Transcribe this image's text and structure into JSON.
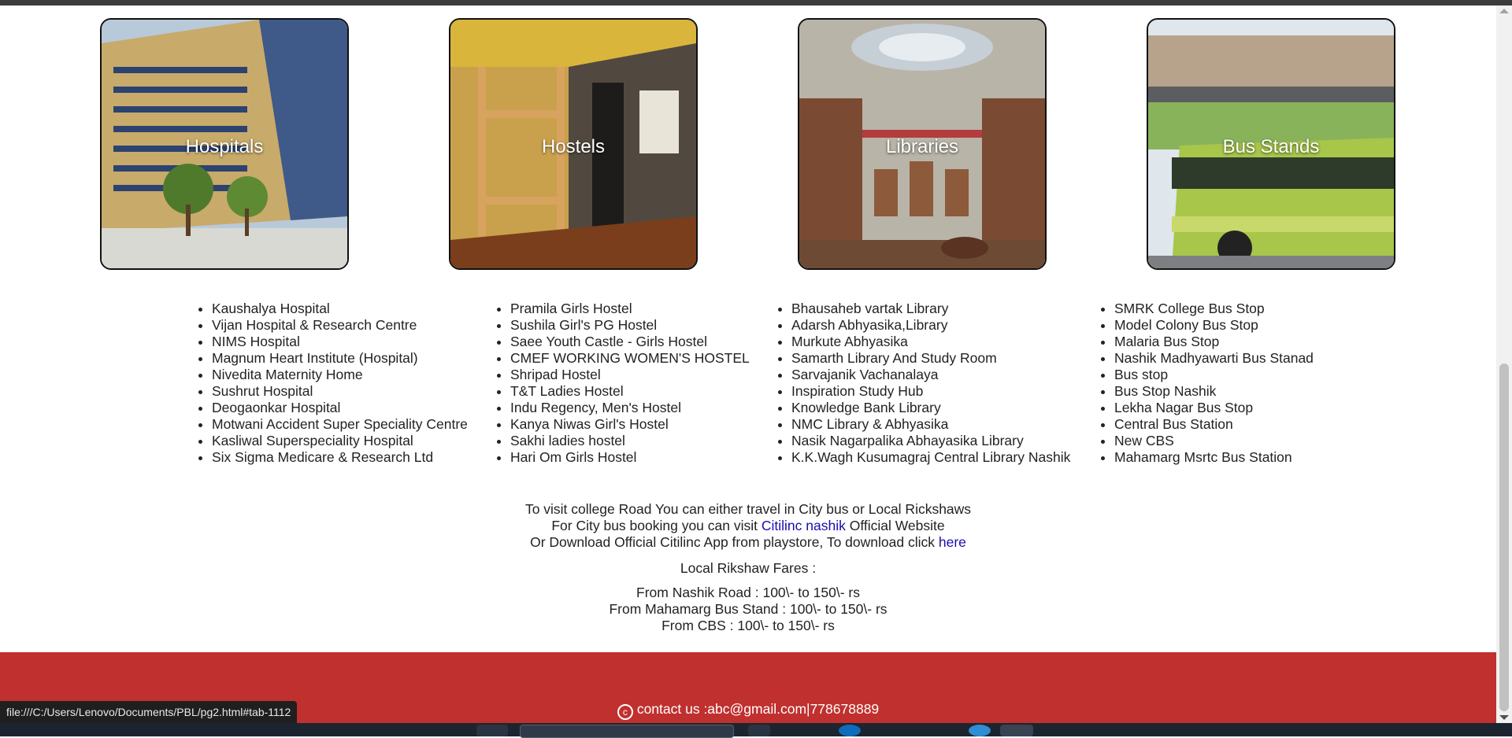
{
  "cards": [
    {
      "title": "Hospitals"
    },
    {
      "title": "Hostels"
    },
    {
      "title": "Libraries"
    },
    {
      "title": "Bus Stands"
    }
  ],
  "lists": {
    "hospitals": [
      "Kaushalya Hospital",
      "Vijan Hospital & Research Centre",
      "NIMS Hospital",
      "Magnum Heart Institute (Hospital)",
      "Nivedita Maternity Home",
      "Sushrut Hospital",
      "Deogaonkar Hospital",
      "Motwani Accident Super Speciality Centre",
      "Kasliwal Superspeciality Hospital",
      "Six Sigma Medicare & Research Ltd"
    ],
    "hostels": [
      "Pramila Girls Hostel",
      "Sushila Girl's PG Hostel",
      "Saee Youth Castle - Girls Hostel",
      "CMEF WORKING WOMEN'S HOSTEL",
      "Shripad Hostel",
      "T&T Ladies Hostel",
      "Indu Regency, Men's Hostel",
      "Kanya Niwas Girl's Hostel",
      "Sakhi ladies hostel",
      "Hari Om Girls Hostel"
    ],
    "libraries": [
      "Bhausaheb vartak Library",
      "Adarsh Abhyasika,Library",
      "Murkute Abhyasika",
      "Samarth Library And Study Room",
      "Sarvajanik Vachanalaya",
      "Inspiration Study Hub",
      "Knowledge Bank Library",
      "NMC Library & Abhyasika",
      "Nasik Nagarpalika Abhayasika Library",
      "K.K.Wagh Kusumagraj Central Library Nashik"
    ],
    "busstands": [
      "SMRK College Bus Stop",
      "Model Colony Bus Stop",
      "Malaria Bus Stop",
      "Nashik Madhyawarti Bus Stanad",
      "Bus stop",
      "Bus Stop Nashik",
      "Lekha Nagar Bus Stop",
      "Central Bus Station",
      "New CBS",
      "Mahamarg Msrtc Bus Station"
    ]
  },
  "info": {
    "line1": "To visit college Road You can either travel in City bus or Local Rickshaws",
    "line2_prefix": "For City bus booking you can visit ",
    "line2_link": "Citilinc nashik",
    "line2_suffix": " Official Website",
    "line3_prefix": "Or Download Official Citilinc App from playstore, To download click ",
    "line3_link": "here",
    "fares_title": "Local Rikshaw Fares :",
    "fares": [
      "From Nashik Road : 100\\- to 150\\- rs",
      "From Mahamarg Bus Stand : 100\\- to 150\\- rs",
      "From CBS : 100\\- to 150\\- rs"
    ]
  },
  "footer": {
    "icon": "copyright-icon",
    "contact": "contact us :abc@gmail.com|778678889"
  },
  "status_bar": {
    "url": "file:///C:/Users/Lenovo/Documents/PBL/pg2.html#tab-1112"
  },
  "colors": {
    "footer_bg": "#c0302e",
    "link": "#1a0dab"
  }
}
